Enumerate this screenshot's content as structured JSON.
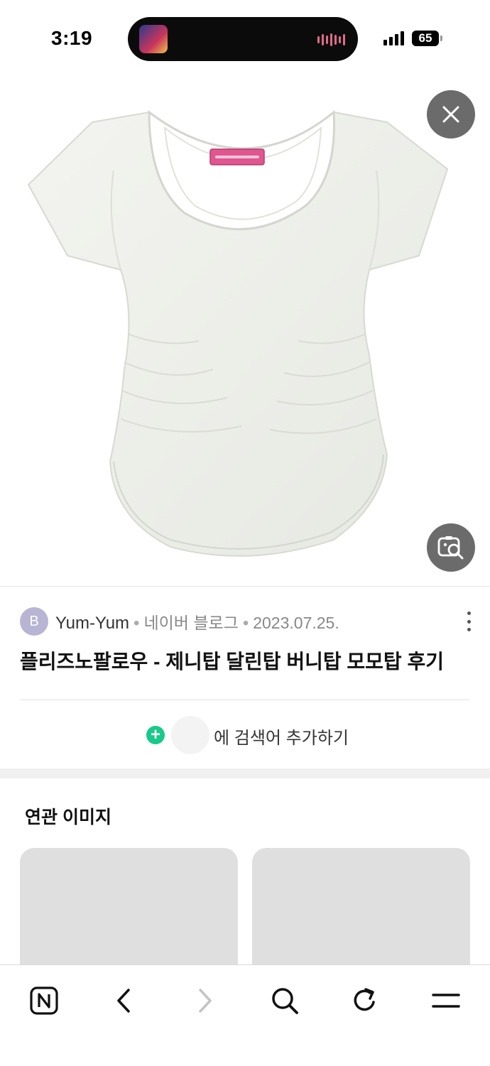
{
  "status_bar": {
    "time": "3:19",
    "battery": "65"
  },
  "image_viewer": {
    "close_icon": "close-icon",
    "lens_icon": "image-search-icon",
    "image_subject": "white scoop-neck cap-sleeve ruched top with pink label"
  },
  "result": {
    "avatar_letter": "B",
    "author": "Yum-Yum",
    "source": "네이버 블로그",
    "date": "2023.07.25.",
    "title": "플리즈노팔로우 - 제니탑 달린탑 버니탑 모모탑 후기"
  },
  "add_search": {
    "label": "에 검색어 추가하기"
  },
  "related": {
    "title": "연관 이미지"
  },
  "toolbar": {
    "icons": [
      "naver-home-icon",
      "back-icon",
      "forward-icon",
      "search-icon",
      "refresh-icon",
      "menu-icon"
    ]
  },
  "colors": {
    "accent_green": "#18c98a",
    "overlay_button": "#6b6b6b",
    "placeholder": "#dfdfdf"
  }
}
